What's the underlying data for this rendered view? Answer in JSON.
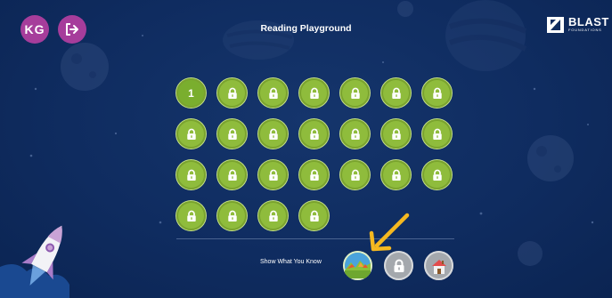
{
  "header": {
    "avatar_initials": "KG",
    "title": "Reading Playground",
    "brand_name": "BLAST",
    "brand_sub": "FOUNDATIONS"
  },
  "levels": {
    "current_label": "1",
    "total": 25,
    "unlocked": 1
  },
  "show_what_you_know": {
    "label": "Show What You Know"
  },
  "colors": {
    "background": "#0f2c60",
    "level_green": "#8fbc3c",
    "avatar_purple": "#a63d9b",
    "locked_grey": "#a4a8ad",
    "highlight_arrow": "#f5b820"
  },
  "icons": [
    "logout-icon",
    "lock-icon",
    "brand-logo-icon",
    "landscape-icon",
    "house-icon",
    "rocket-icon",
    "arrow-pointer-icon"
  ]
}
